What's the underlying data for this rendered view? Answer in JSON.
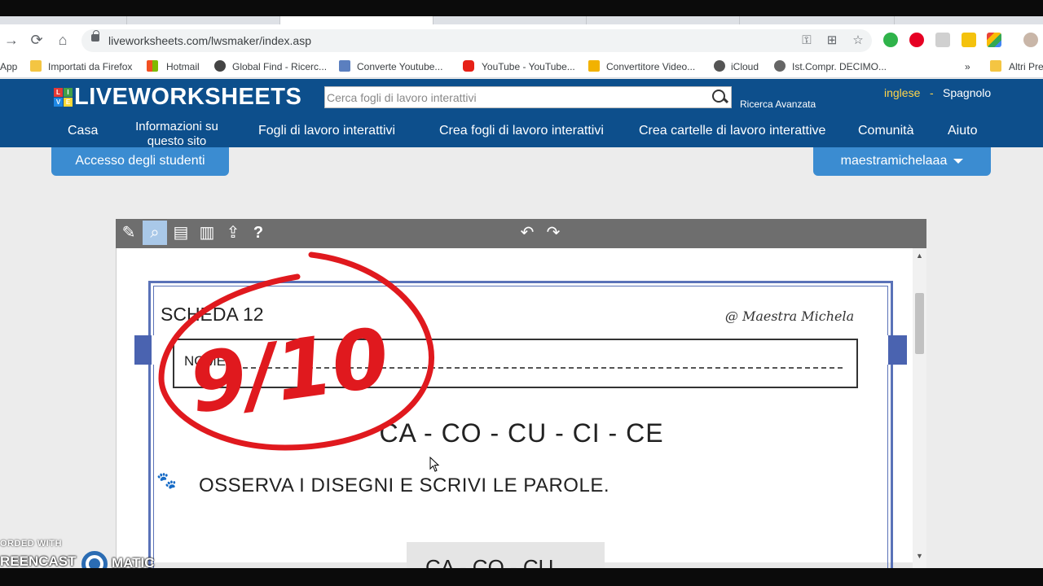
{
  "browser": {
    "url": "liveworksheets.com/lwsmaker/index.asp",
    "bookmarks": [
      {
        "label": "App"
      },
      {
        "label": "Importati da Firefox"
      },
      {
        "label": "Hotmail"
      },
      {
        "label": "Global Find - Ricerc..."
      },
      {
        "label": "Converte Youtube..."
      },
      {
        "label": "YouTube - YouTube..."
      },
      {
        "label": "Convertitore Video..."
      },
      {
        "label": "iCloud"
      },
      {
        "label": "Ist.Compr. DECIMO..."
      },
      {
        "label": "»"
      },
      {
        "label": "Altri Pre"
      }
    ]
  },
  "site": {
    "logo": "LIVEWORKSHEETS",
    "search_placeholder": "Cerca fogli di lavoro interattivi",
    "advanced_search": "Ricerca Avanzata",
    "lang_en": "inglese",
    "lang_sep": "-",
    "lang_es": "Spagnolo",
    "nav": {
      "home": "Casa",
      "info": "Informazioni su questo sito",
      "worksheets": "Fogli di lavoro interattivi",
      "create_worksheets": "Crea fogli di lavoro interattivi",
      "create_workbooks": "Crea cartelle di lavoro interattive",
      "community": "Comunità",
      "help": "Aiuto"
    },
    "student_access": "Accesso degli studenti",
    "username": "maestramichelaaa"
  },
  "editor": {
    "help_tool": "?"
  },
  "worksheet": {
    "title": "SCHEDA 12",
    "author": "@ Maestra Michela",
    "name_label": "NOME",
    "syllables": "CA - CO - CU - CI - CE",
    "instruction": "OSSERVA I DISEGNI E SCRIVI LE PAROLE.",
    "preview": "CA - CO - CU",
    "grade": "9/10"
  },
  "watermark": {
    "line1": "ORDED WITH",
    "line2": "REENCAST",
    "line3": "MATIC"
  },
  "colors": {
    "header": "#0d4f8c",
    "button": "#3b8cd1",
    "lang_active": "#ffd54a",
    "grade_red": "#e0191e",
    "frame_blue": "#4a63b0"
  }
}
